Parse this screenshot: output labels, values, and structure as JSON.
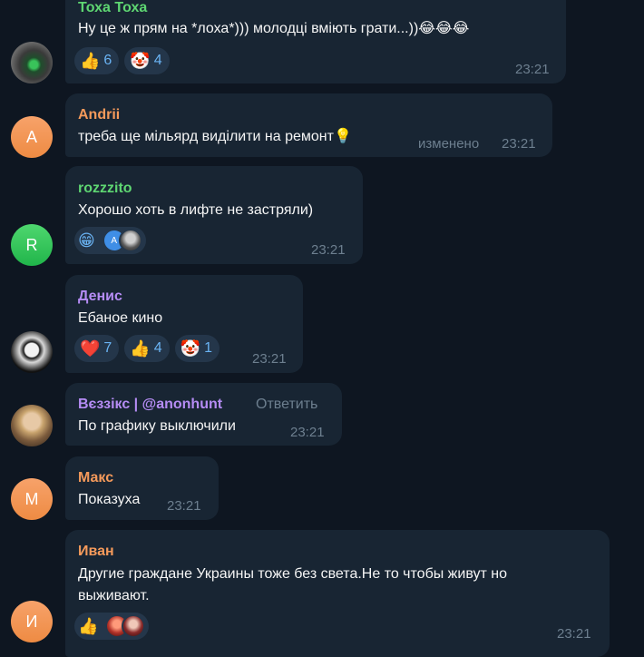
{
  "messages": [
    {
      "sender": "Тоха Тоха",
      "text": "Ну це ж прям на *лоха*))) молодці вміють грати...))😂😂😂",
      "reactions": [
        {
          "emoji": "👍",
          "count": "6"
        },
        {
          "emoji": "🤡",
          "count": "4"
        }
      ],
      "time": "23:21",
      "avatar_icon": "photo-avatar"
    },
    {
      "sender": "Andrii",
      "text": "треба ще мільярд виділити на ремонт💡",
      "edited_label": "изменено",
      "time": "23:21",
      "avatar_letter": "A"
    },
    {
      "sender": "rozzzito",
      "text": "Хорошо хоть в лифте не застряли)",
      "reaction_emoji": "😁",
      "reaction_avatar_letter": "A",
      "time": "23:21",
      "avatar_letter": "R"
    },
    {
      "sender": "Денис",
      "text": "Ебаное кино",
      "reactions": [
        {
          "emoji": "❤️",
          "count": "7"
        },
        {
          "emoji": "👍",
          "count": "4"
        },
        {
          "emoji": "🤡",
          "count": "1"
        }
      ],
      "time": "23:21",
      "avatar_icon": "photo-avatar"
    },
    {
      "sender": "Вєззікс | @anonhunt",
      "reply_label": "Ответить",
      "text": "По графику выключили",
      "time": "23:21",
      "avatar_icon": "photo-avatar"
    },
    {
      "sender": "Макс",
      "text": "Показуха",
      "time": "23:21",
      "avatar_letter": "M"
    },
    {
      "sender": "Иван",
      "text_line1": "Другие граждане Украины тоже без света.Не то чтобы живут но",
      "text_line2": "выживают.",
      "reaction_emoji": "👍",
      "time": "23:21",
      "avatar_letter": "И"
    }
  ],
  "colors": {
    "background": "#0e1621",
    "bubble": "#182533",
    "name_green": "#5ed672",
    "name_orange": "#f59a5b",
    "name_purple": "#b58cf4",
    "reaction_count": "#6ab3f3",
    "time": "#6d7f8f"
  }
}
